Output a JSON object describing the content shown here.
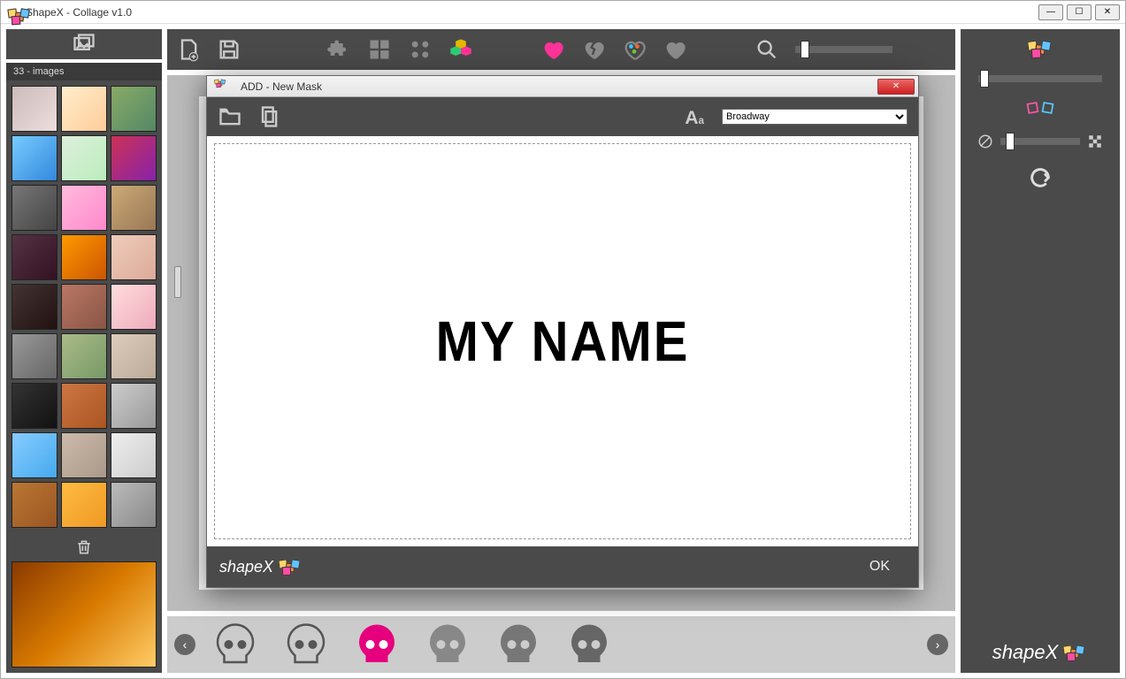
{
  "window": {
    "title": "ShapeX - Collage v1.0"
  },
  "sidebar": {
    "images_label": "33 - images",
    "thumb_count": 27
  },
  "toolbar": {
    "icons": [
      "gallery",
      "add-file",
      "save",
      "puzzle",
      "grid",
      "dots",
      "hex-color",
      "heart-fill",
      "heart-broken",
      "heart-color",
      "heart-solid",
      "search",
      "zoom-slider"
    ]
  },
  "right_panel": {
    "icons": [
      "shuffle-shapes",
      "size-slider",
      "rotate-shapes",
      "opacity-slider",
      "undo"
    ]
  },
  "modal": {
    "title": "ADD - New Mask",
    "font_selected": "Broadway",
    "font_options": [
      "Broadway"
    ],
    "mask_text": "MY NAME",
    "ok_label": "OK"
  },
  "brand": {
    "name": "shapeX"
  },
  "footer_items": [
    "skull-outline-1",
    "skull-outline-2",
    "skull-pink",
    "skull-gray-1",
    "skull-gray-2",
    "skull-gray-3"
  ]
}
